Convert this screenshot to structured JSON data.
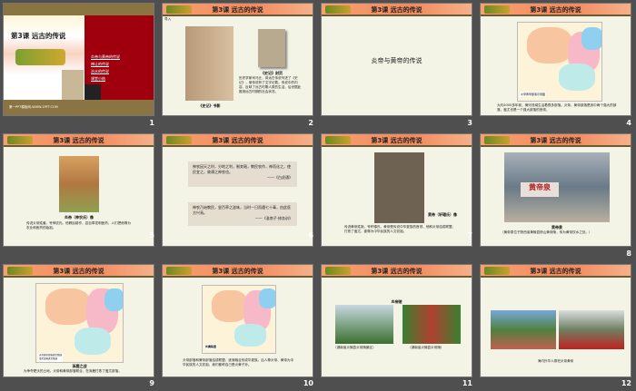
{
  "lesson_title": "第3课 远古的传说",
  "slides": [
    {
      "num": "1",
      "title": "第3课  远古的传说",
      "menu": [
        "炎帝与黄帝的传说",
        "禅让的传说",
        "治水的传说",
        "课堂小结"
      ],
      "footer": "第一PPT模板网-WWW.1PPT.COM"
    },
    {
      "num": "2",
      "label": "导入",
      "cap_left": "《史记》书影",
      "cap_right": "《史记》封页",
      "text": "历史学家司马迁，将远古传说写进了《史记》，使传说有了文字记载。传说中的内容，反映了远古时期人类的生活，后世据此推测远古时期的社会状况。"
    },
    {
      "num": "3",
      "center": "炎帝与黄帝的传说"
    },
    {
      "num": "4",
      "legend": "炎帝黄帝部落示意图",
      "text": "大约4000多年前，黄河流域生活着很多部落。炎帝、黄帝部落是其中两个强大的部落，蚩尤也是一个强大部落的首领。"
    },
    {
      "num": "5",
      "caption": "炎帝（神农氏）像",
      "text": "传说炎帝姓姜，号神农氏。他教民耕作，尝百草发明医药，人们把他尊为农业和医药的始祖。"
    },
    {
      "num": "6",
      "quote1": "神农因天之时，分地之利，制耒耜，教民农作，神而化之，使民宜之，故谓之神农也。",
      "src1": "——《白虎通》",
      "quote2": "神农乃始教民，尝百草之滋味，当时一日而遇七十毒，由此医方兴焉。",
      "src2": "——《淮南子·修务训》"
    },
    {
      "num": "7",
      "caption": "黄帝（轩辕氏）像",
      "text": "传说黄帝姓姬，号轩辕氏。黄帝是传说中华夏族的首领，他和炎帝结成联盟，打败了蚩尤，被尊为中华民族的人文初祖。"
    },
    {
      "num": "8",
      "caption": "黄帝泉",
      "text": "（黄帝泉位于陕西省黄陵县桥山黄帝陵，传为黄帝饮水之处。）"
    },
    {
      "num": "9",
      "caption": "涿鹿之战",
      "text": "为争夺肥沃的土地，炎帝和黄帝部落联合，在涿鹿打败了蚩尤部落。",
      "legend": [
        "炎帝黄帝部落进军路线",
        "蚩尤部落进军路线"
      ]
    },
    {
      "num": "10",
      "label": "炎黄联盟",
      "text": "炎帝部落和黄帝部落结成联盟，逐渐融合形成华夏族。后人尊炎帝、黄帝为中华民族的人文初祖，我们都称自己是炎黄子孙。"
    },
    {
      "num": "11",
      "title": "炎帝陵",
      "cap_left": "（湖南省炎陵县炎帝陵景区）",
      "cap_right": "（湖南省炎陵县炎帝陵）"
    },
    {
      "num": "12",
      "caption": "海内外华人祭祀炎帝黄帝"
    }
  ],
  "colors": {
    "background": "#4f4f4f",
    "header": "#f28a5e",
    "slide_bg": "#f3f3e6",
    "title_red": "#a00010"
  }
}
